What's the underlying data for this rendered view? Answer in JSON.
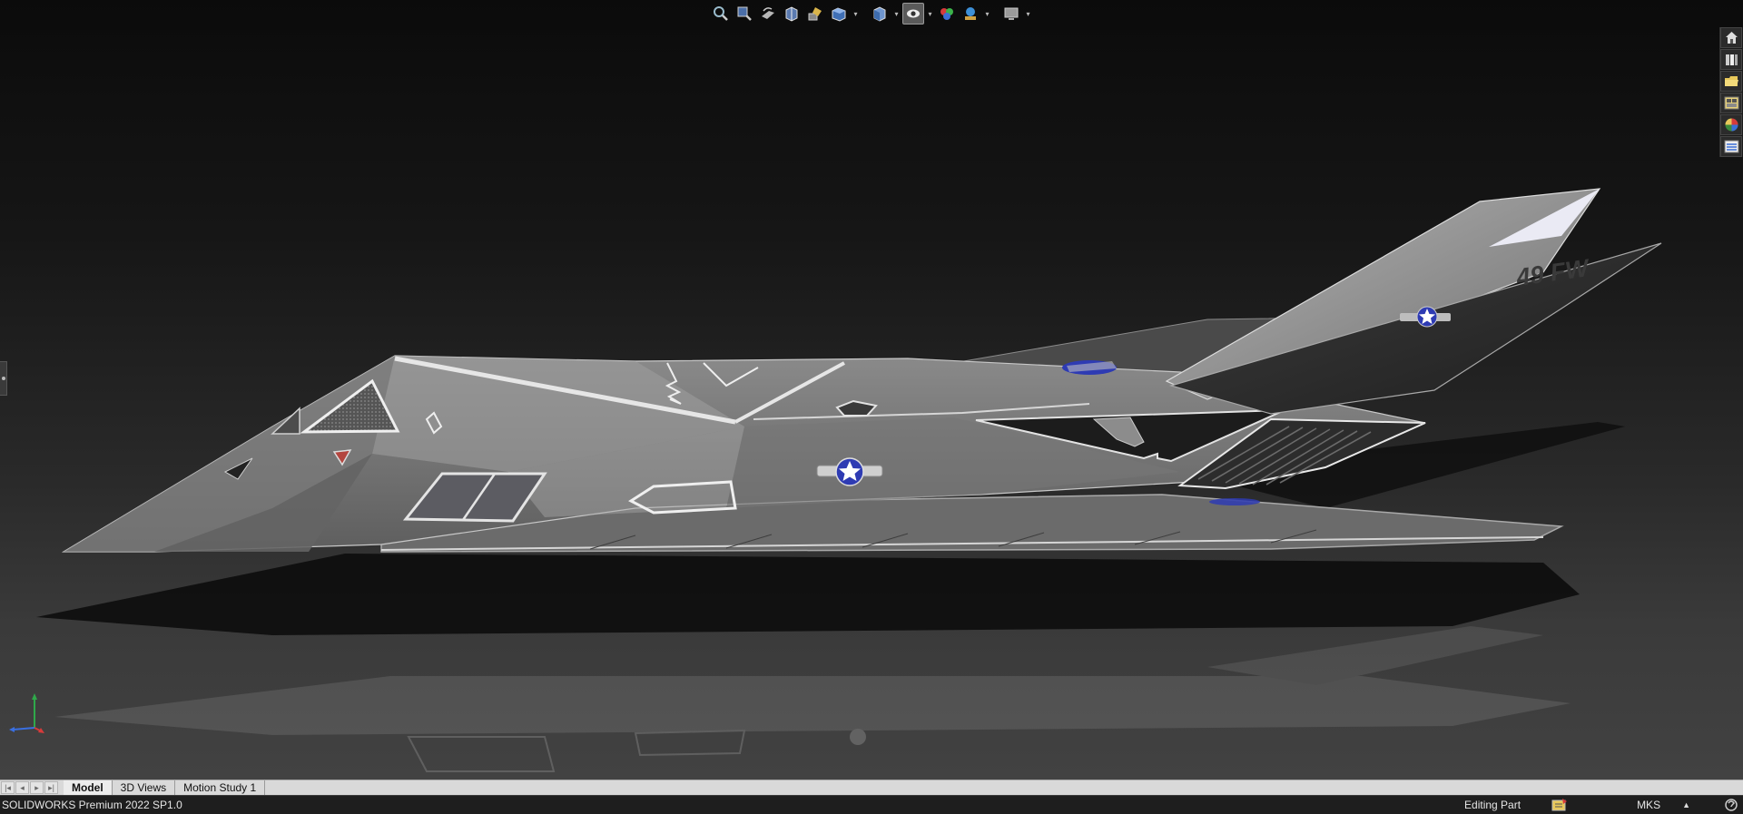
{
  "app": {
    "title": "SOLIDWORKS Premium 2022 SP1.0"
  },
  "model": {
    "tail_marking": "49 FW",
    "insignia_color": "#2e3bb3"
  },
  "heads_up_toolbar": {
    "items": [
      {
        "name": "zoom-to-fit-icon"
      },
      {
        "name": "zoom-to-area-icon"
      },
      {
        "name": "previous-view-icon"
      },
      {
        "name": "section-view-icon"
      },
      {
        "name": "dynamic-annotation-view-icon"
      },
      {
        "name": "view-orientation-icon"
      },
      {
        "name": "display-style-icon"
      },
      {
        "name": "hide-show-items-icon",
        "active": true
      },
      {
        "name": "edit-appearance-icon"
      },
      {
        "name": "apply-scene-icon"
      },
      {
        "name": "view-settings-icon"
      }
    ]
  },
  "task_pane": {
    "tabs": [
      {
        "name": "solidworks-resources-icon"
      },
      {
        "name": "design-library-icon"
      },
      {
        "name": "file-explorer-icon"
      },
      {
        "name": "view-palette-icon"
      },
      {
        "name": "appearances-scenes-icon"
      },
      {
        "name": "custom-properties-icon"
      }
    ]
  },
  "tabs": {
    "items": [
      {
        "label": "Model",
        "active": true
      },
      {
        "label": "3D Views",
        "active": false
      },
      {
        "label": "Motion Study 1",
        "active": false
      }
    ]
  },
  "status": {
    "product": "SOLIDWORKS Premium 2022 SP1.0",
    "state": "Editing Part",
    "units": "MKS",
    "units_arrow": "▲"
  },
  "colors": {
    "viewport_top": "#0b0b0b",
    "viewport_bottom": "#424242",
    "tabbar": "#d9d9d9",
    "statusbar": "#1e1e1e"
  }
}
